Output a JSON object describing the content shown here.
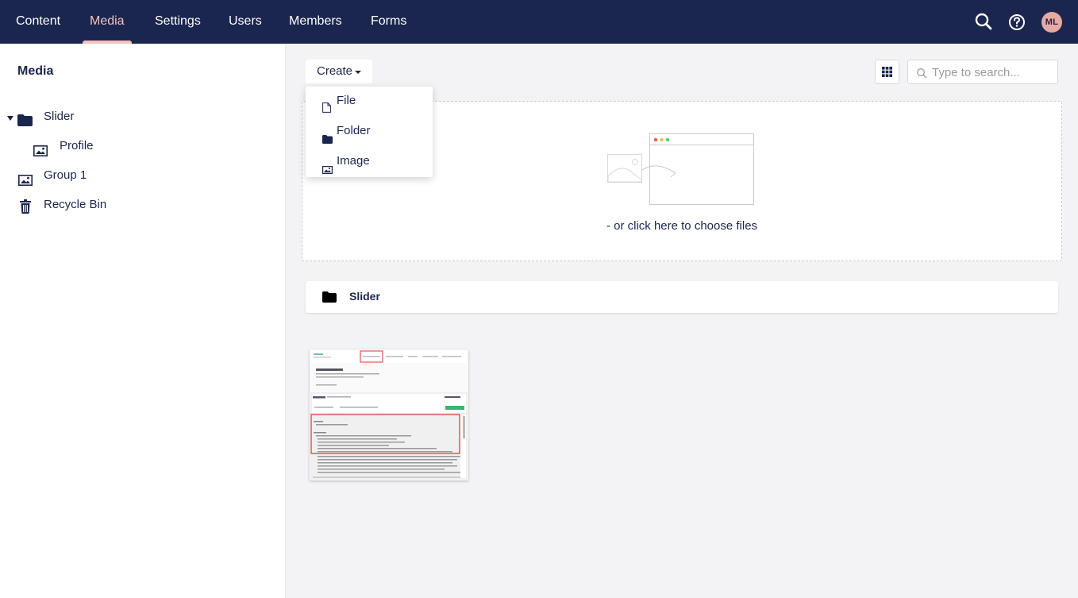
{
  "topnav": {
    "items": [
      {
        "label": "Content",
        "active": false
      },
      {
        "label": "Media",
        "active": true
      },
      {
        "label": "Settings",
        "active": false
      },
      {
        "label": "Users",
        "active": false
      },
      {
        "label": "Members",
        "active": false
      },
      {
        "label": "Forms",
        "active": false
      }
    ],
    "avatar_initials": "ML",
    "colors": {
      "background": "#1b264f",
      "active": "#f5c1bc",
      "avatar": "#e6a9a3"
    }
  },
  "sidebar": {
    "title": "Media",
    "tree": [
      {
        "label": "Slider",
        "icon": "folder-icon",
        "expanded": true
      },
      {
        "label": "Profile",
        "icon": "image-icon"
      },
      {
        "label": "Group 1",
        "icon": "image-icon"
      },
      {
        "label": "Recycle Bin",
        "icon": "trash-icon"
      }
    ]
  },
  "toolbar": {
    "create_label": "Create",
    "search_placeholder": "Type to search..."
  },
  "create_menu": {
    "items": [
      {
        "label": "File",
        "icon": "file-icon"
      },
      {
        "label": "Folder",
        "icon": "folder-icon"
      },
      {
        "label": "Image",
        "icon": "image-icon"
      }
    ]
  },
  "dropzone": {
    "text": "- or click here to choose files"
  },
  "folders": [
    {
      "label": "Slider",
      "icon": "folder-icon"
    }
  ],
  "media_items": [
    {
      "type": "image",
      "icon": "screenshot-thumbnail"
    }
  ]
}
